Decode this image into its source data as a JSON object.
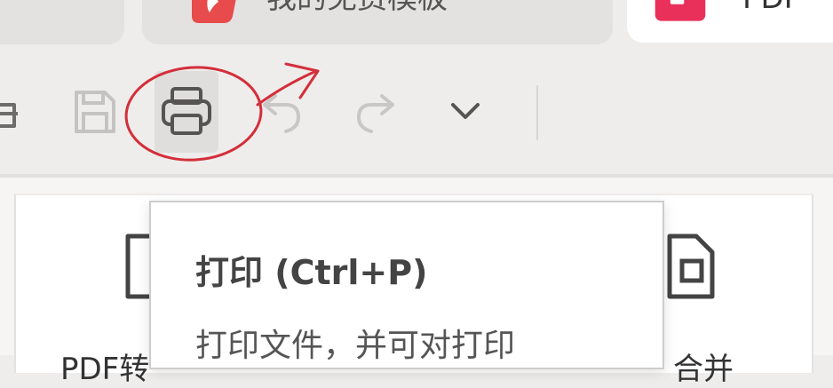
{
  "tabs": [
    {
      "title": ""
    },
    {
      "title": "我的免费模板"
    },
    {
      "title": "PDF"
    }
  ],
  "toolbar": {
    "buttons": [
      {
        "icon": "open-folder-icon"
      },
      {
        "icon": "save-icon"
      },
      {
        "icon": "print-icon"
      },
      {
        "icon": "undo-icon"
      },
      {
        "icon": "redo-icon"
      },
      {
        "icon": "chevron-down-icon"
      }
    ]
  },
  "tooltip": {
    "title": "打印 (Ctrl+P)",
    "description": "打印文件，并可对打印"
  },
  "cards": [
    {
      "label": "PDF转"
    },
    {
      "label": "合并"
    }
  ],
  "colors": {
    "annotation": "#d32f3a",
    "app_brand": "#e84b4b",
    "app_brand_alt": "#e8305a"
  }
}
